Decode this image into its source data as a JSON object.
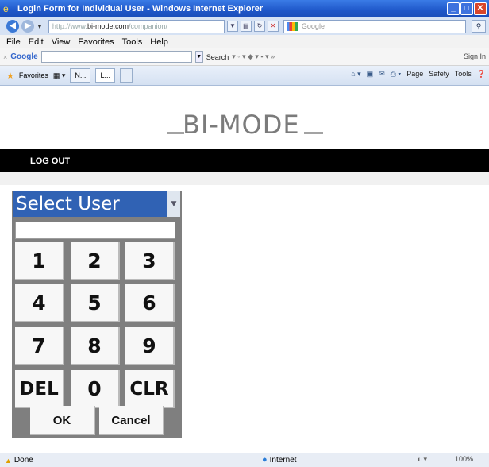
{
  "window": {
    "title": "Login Form for Individual User - Windows Internet Explorer",
    "controls": [
      "_",
      "□",
      "✕"
    ]
  },
  "address_bar": {
    "url_prefix": "http://www.",
    "url_domain": "bi-mode.com",
    "url_suffix": "/companion/",
    "search_placeholder": "Google"
  },
  "menu": {
    "items": [
      "File",
      "Edit",
      "View",
      "Favorites",
      "Tools",
      "Help"
    ]
  },
  "google_toolbar": {
    "close": "×",
    "logo": "Google",
    "search_label": "Search",
    "sign_in": "Sign In"
  },
  "favorites_bar": {
    "favorites_label": "Favorites",
    "tabs": [
      "N...",
      "L..."
    ],
    "commands": [
      "Page",
      "Safety",
      "Tools"
    ]
  },
  "page": {
    "logo": "BI-MODE",
    "nav": {
      "logout": "LOG OUT"
    },
    "login": {
      "user_select": "Select User",
      "pin_value": "",
      "keypad": [
        "1",
        "2",
        "3",
        "4",
        "5",
        "6",
        "7",
        "8",
        "9",
        "DEL",
        "0",
        "CLR"
      ],
      "ok": "OK",
      "cancel": "Cancel"
    }
  },
  "status_bar": {
    "status": "Done",
    "zone": "Internet",
    "zoom": "100%"
  }
}
